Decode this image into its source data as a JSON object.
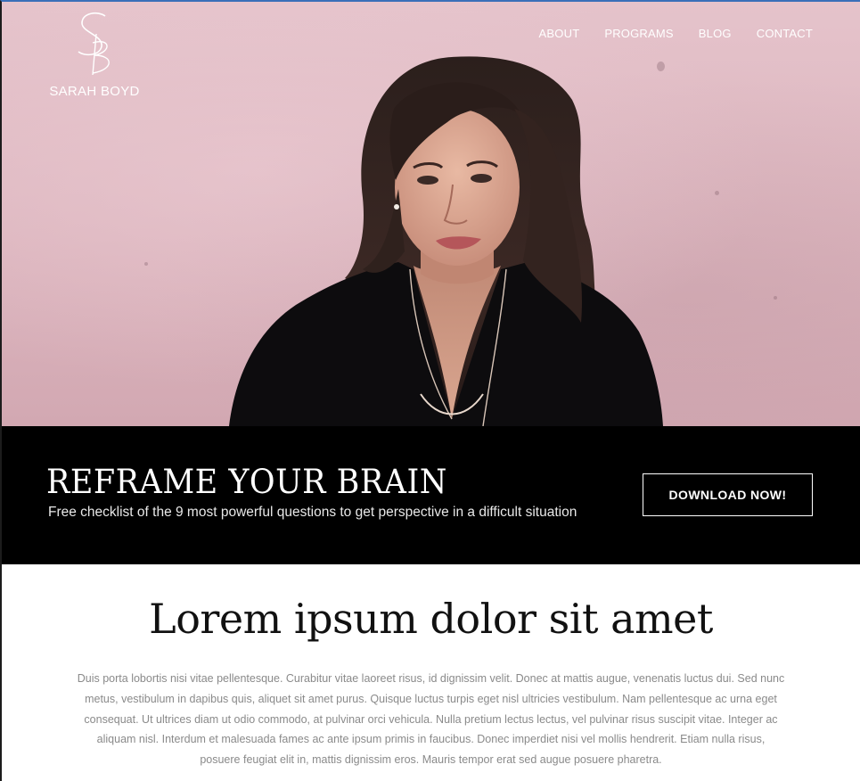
{
  "site": {
    "logo_monogram": "SB",
    "logo_name": "SARAH BOYD"
  },
  "nav": {
    "items": [
      {
        "label": "ABOUT"
      },
      {
        "label": "PROGRAMS"
      },
      {
        "label": "BLOG"
      },
      {
        "label": "CONTACT"
      }
    ]
  },
  "hero": {
    "image": "portrait of a smiling woman with long dark wavy hair in a black v-neck top against a pink wall"
  },
  "cta": {
    "title": "REFRAME YOUR BRAIN",
    "subtitle": "Free checklist of the 9 most powerful questions to get perspective in a difficult situation",
    "button_label": "DOWNLOAD NOW!"
  },
  "content": {
    "title": "Lorem ipsum dolor sit amet",
    "body": "Duis porta lobortis nisi vitae pellentesque. Curabitur vitae laoreet risus, id dignissim velit. Donec at mattis augue, venenatis luctus dui. Sed nunc metus, vestibulum in dapibus quis, aliquet sit amet purus. Quisque luctus turpis eget nisl ultricies vestibulum. Nam pellentesque ac urna eget consequat. Ut ultrices diam ut odio commodo, at pulvinar orci vehicula. Nulla pretium lectus lectus, vel pulvinar risus suscipit vitae. Integer ac aliquam nisl. Interdum et malesuada fames ac ante ipsum primis in faucibus. Donec imperdiet nisi vel mollis hendrerit. Etiam nulla risus, posuere feugiat elit in, mattis dignissim eros. Mauris tempor erat sed augue posuere pharetra."
  },
  "colors": {
    "wall_pink": "#dcb5be",
    "band_black": "#000000",
    "text_white": "#ffffff",
    "body_gray": "#8a8a8a"
  }
}
